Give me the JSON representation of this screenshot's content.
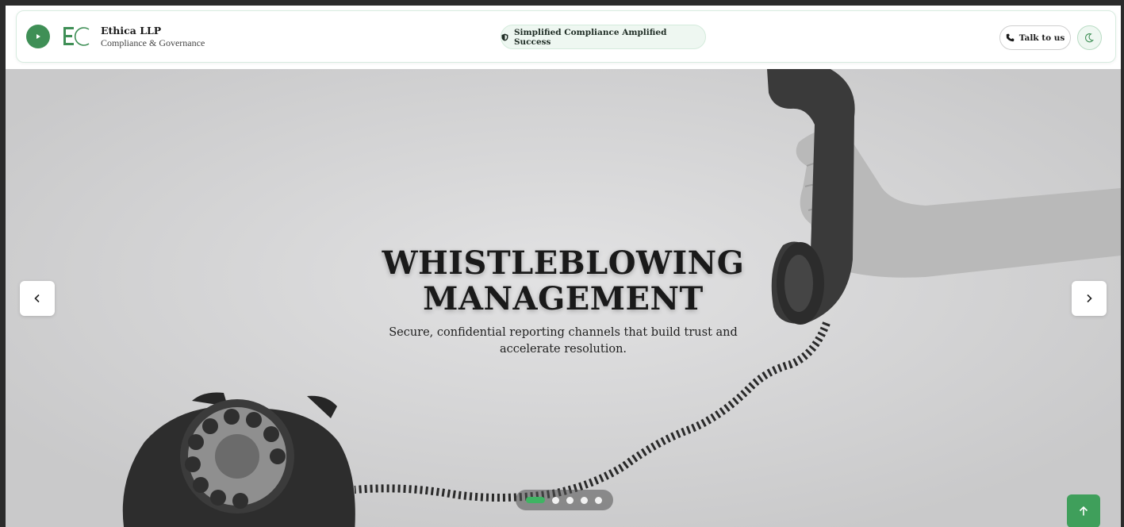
{
  "header": {
    "brand_name": "Ethica LLP",
    "brand_tagline": "Compliance & Governance",
    "pill_text": "Simplified Compliance Amplified Success",
    "talk_label": "Talk to us",
    "icons": {
      "menu": "play-icon",
      "logo": "ec-logo-icon",
      "pill": "shield-icon",
      "talk": "phone-icon",
      "theme": "moon-icon"
    }
  },
  "hero": {
    "title_line1": "WHISTLEBLOWING",
    "title_line2": "MANAGEMENT",
    "subtitle": "Secure, confidential reporting channels that build trust and accelerate resolution.",
    "slides_total": 5,
    "active_slide": 1
  },
  "colors": {
    "brand_green": "#3f8f56",
    "active_dot": "#3fb463",
    "scroll_top_button": "#3f9f5b"
  }
}
